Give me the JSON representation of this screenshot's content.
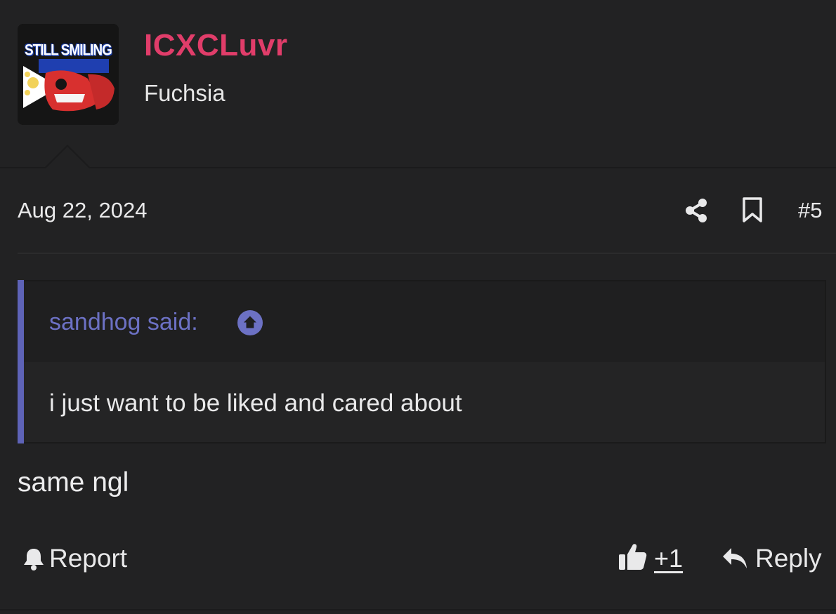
{
  "user": {
    "name": "ICXCLuvr",
    "title": "Fuchsia",
    "avatar_text": "STILL SMILING",
    "name_color": "#e13d6a"
  },
  "post": {
    "date": "Aug 22, 2024",
    "number": "#5",
    "body": "same ngl"
  },
  "quote": {
    "author": "sandhog said:",
    "text": "i just want to be liked and cared about",
    "accent_color": "#5e63b7"
  },
  "actions": {
    "report": "Report",
    "like_count": "+1",
    "reply": "Reply"
  },
  "icons": {
    "share": "share-icon",
    "bookmark": "bookmark-icon",
    "quote_jump": "arrow-up-circle-icon",
    "report": "bell-icon",
    "like": "thumbs-up-icon",
    "reply": "reply-arrow-icon"
  }
}
